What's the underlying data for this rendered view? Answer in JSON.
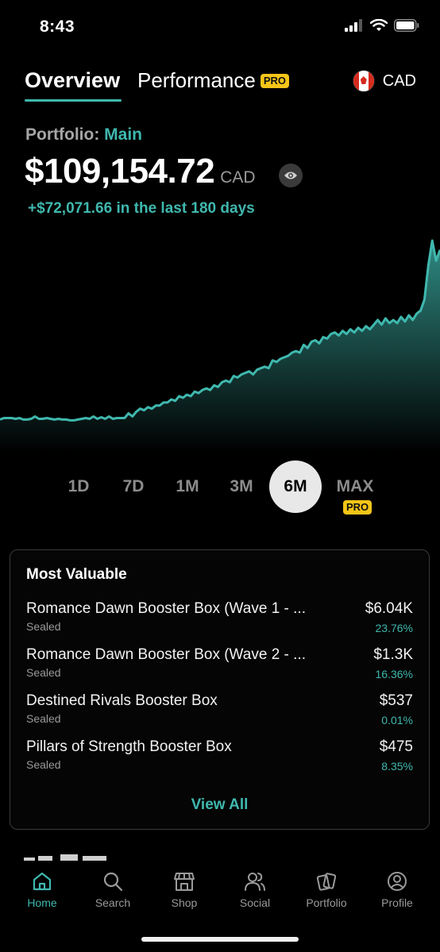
{
  "status_bar": {
    "time": "8:43"
  },
  "tabs": {
    "overview": "Overview",
    "performance": "Performance",
    "pro_badge": "PRO"
  },
  "currency": {
    "code": "CAD",
    "flag": "canada-flag-icon"
  },
  "portfolio": {
    "label": "Portfolio:",
    "name": "Main",
    "total_value": "$109,154.72",
    "total_currency": "CAD",
    "change_text": "+$72,071.66 in the last 180 days"
  },
  "chart_data": {
    "type": "area",
    "color": "#3fb8ae",
    "period": "6M",
    "values": [
      22,
      24,
      24,
      24,
      23,
      24,
      22,
      22,
      23,
      26,
      23,
      23,
      24,
      23,
      22,
      23,
      22,
      22,
      21,
      21,
      22,
      23,
      24,
      23,
      26,
      23,
      25,
      23,
      26,
      23,
      24,
      24,
      24,
      30,
      26,
      32,
      36,
      34,
      38,
      36,
      40,
      40,
      44,
      44,
      48,
      46,
      52,
      50,
      54,
      52,
      58,
      56,
      60,
      62,
      60,
      66,
      64,
      70,
      72,
      70,
      78,
      76,
      80,
      82,
      84,
      80,
      86,
      88,
      90,
      88,
      98,
      96,
      100,
      102,
      104,
      108,
      110,
      108,
      118,
      114,
      122,
      124,
      120,
      128,
      126,
      132,
      134,
      130,
      136,
      132,
      138,
      134,
      140,
      136,
      142,
      138,
      144,
      150,
      144,
      152,
      146,
      150,
      146,
      154,
      148,
      156,
      150,
      158,
      162,
      176,
      220,
      252,
      226,
      240
    ]
  },
  "range": {
    "options": [
      "1D",
      "7D",
      "1M",
      "3M",
      "6M",
      "MAX"
    ],
    "active": "6M",
    "max_badge": "PRO"
  },
  "most_valuable": {
    "title": "Most Valuable",
    "items": [
      {
        "name": "Romance Dawn Booster Box (Wave 1 - ...",
        "category": "Sealed",
        "price": "$6.04K",
        "change": "23.76%"
      },
      {
        "name": "Romance Dawn Booster Box (Wave 2 - ...",
        "category": "Sealed",
        "price": "$1.3K",
        "change": "16.36%"
      },
      {
        "name": "Destined Rivals Booster Box",
        "category": "Sealed",
        "price": "$537",
        "change": "0.01%"
      },
      {
        "name": "Pillars of Strength Booster Box",
        "category": "Sealed",
        "price": "$475",
        "change": "8.35%"
      }
    ],
    "view_all": "View All"
  },
  "bottom_nav": {
    "items": [
      {
        "label": "Home",
        "icon": "home-icon"
      },
      {
        "label": "Search",
        "icon": "search-icon"
      },
      {
        "label": "Shop",
        "icon": "shop-icon"
      },
      {
        "label": "Social",
        "icon": "social-icon"
      },
      {
        "label": "Portfolio",
        "icon": "portfolio-icon"
      },
      {
        "label": "Profile",
        "icon": "profile-icon"
      }
    ],
    "active": "Home"
  }
}
